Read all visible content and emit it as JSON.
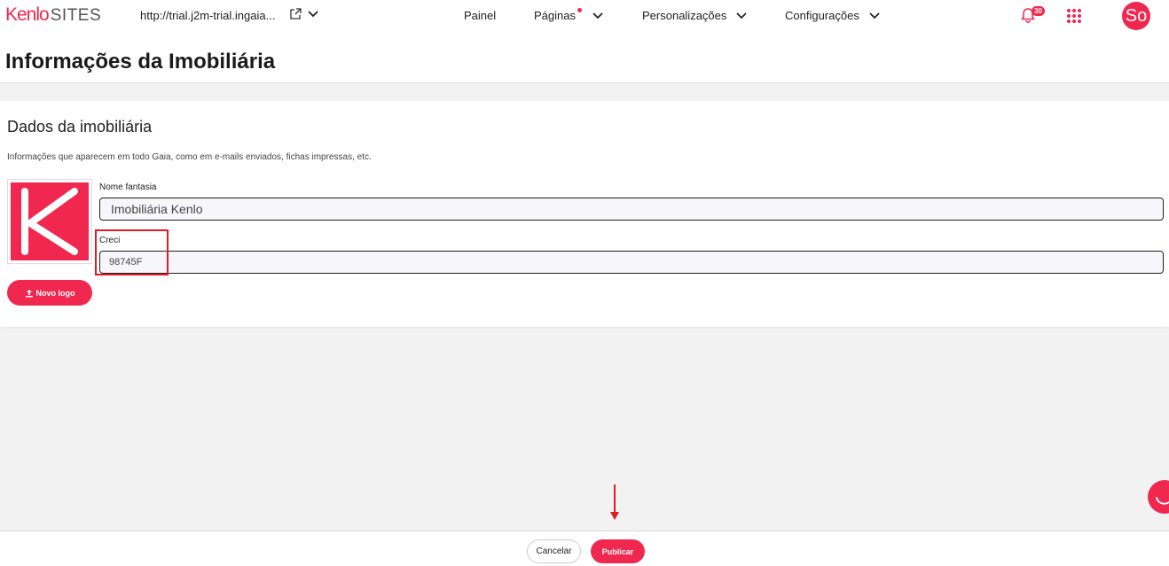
{
  "header": {
    "logo_brand": "Kenlo",
    "logo_product": "SITES",
    "site_url": "http://trial.j2m-trial.ingaia...",
    "nav": [
      {
        "label": "Painel",
        "has_dropdown": false,
        "has_dot": false
      },
      {
        "label": "Páginas",
        "has_dropdown": true,
        "has_dot": true
      },
      {
        "label": "Personalizações",
        "has_dropdown": true,
        "has_dot": false
      },
      {
        "label": "Configurações",
        "has_dropdown": true,
        "has_dot": false
      }
    ],
    "notification_count": "30",
    "avatar_initials": "So",
    "icons": [
      "external-link-icon",
      "chevron-down-icon",
      "bell-icon",
      "apps-grid-icon"
    ]
  },
  "page": {
    "title": "Informações da Imobiliária"
  },
  "card": {
    "title": "Dados da imobiliária",
    "description": "Informações que aparecem em todo Gaia, como em e-mails enviados, fichas impressas, etc.",
    "nome_fantasia_label": "Nome fantasia",
    "nome_fantasia_value": "Imobiliária Kenlo",
    "creci_label": "Creci",
    "creci_value": "98745F",
    "new_logo_label": "Novo logo"
  },
  "footer": {
    "cancel_label": "Cancelar",
    "publish_label": "Publicar"
  },
  "colors": {
    "accent": "#f0284f",
    "annotation": "#e01b24"
  }
}
